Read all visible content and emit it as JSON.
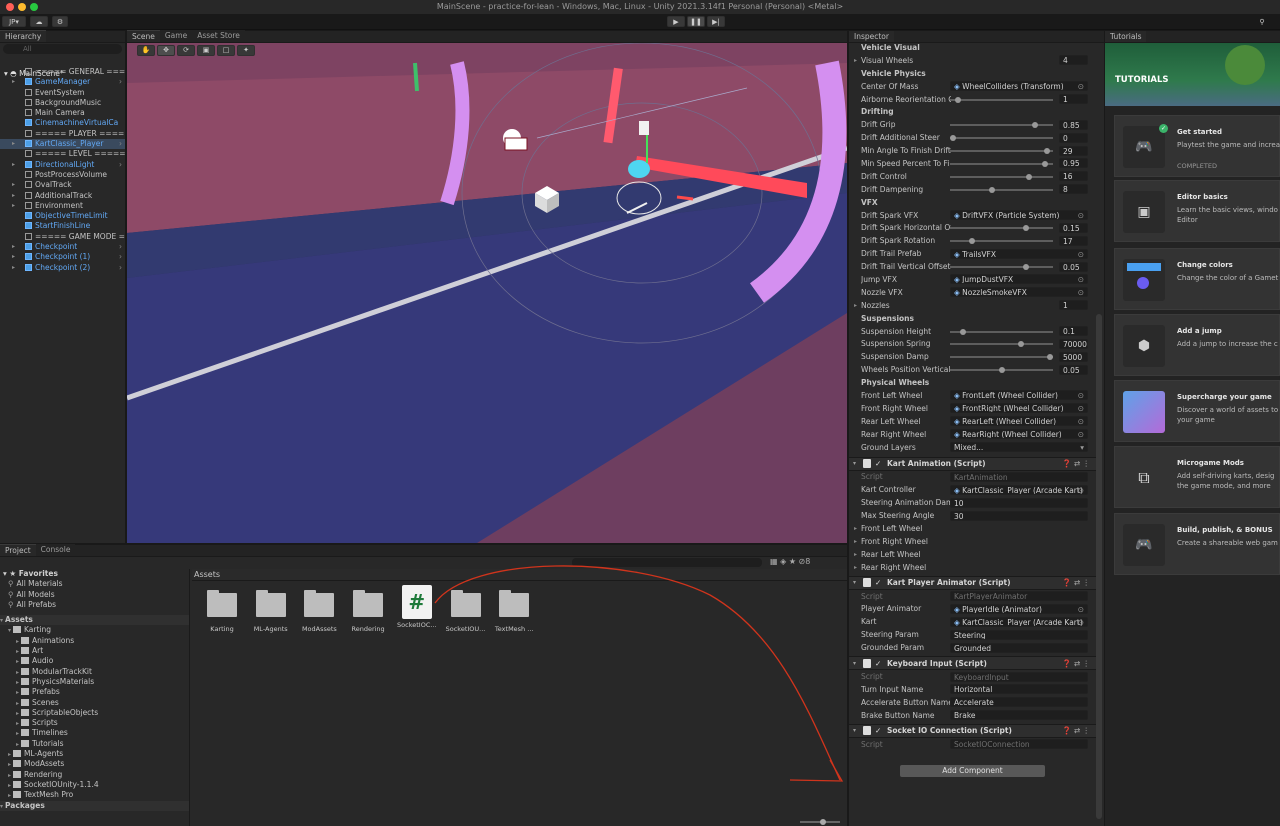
{
  "window": {
    "title": "MainScene - practice-for-lean - Windows, Mac, Linux - Unity 2021.3.14f1 Personal (Personal) <Metal>"
  },
  "toolbar": {
    "account": "JP"
  },
  "hierarchy": {
    "tab": "Hierarchy",
    "search_placeholder": "All",
    "scene": "MainScene*",
    "items": [
      {
        "label": "===== GENERAL =====",
        "blue": false,
        "arrow": false
      },
      {
        "label": "GameManager",
        "blue": true,
        "arrow": true
      },
      {
        "label": "EventSystem",
        "blue": false,
        "arrow": false
      },
      {
        "label": "BackgroundMusic",
        "blue": false,
        "arrow": false
      },
      {
        "label": "Main Camera",
        "blue": false,
        "arrow": false
      },
      {
        "label": "CinemachineVirtualCa",
        "blue": true,
        "arrow": false
      },
      {
        "label": "===== PLAYER =====",
        "blue": false,
        "arrow": false
      },
      {
        "label": "KartClassic_Player",
        "blue": true,
        "arrow": true
      },
      {
        "label": "===== LEVEL =====",
        "blue": false,
        "arrow": false
      },
      {
        "label": "DirectionalLight",
        "blue": true,
        "arrow": true
      },
      {
        "label": "PostProcessVolume",
        "blue": false,
        "arrow": false
      },
      {
        "label": "OvalTrack",
        "blue": false,
        "arrow": true
      },
      {
        "label": "AdditionalTrack",
        "blue": false,
        "arrow": true
      },
      {
        "label": "Environment",
        "blue": false,
        "arrow": true
      },
      {
        "label": "ObjectiveTimeLimit",
        "blue": true,
        "arrow": false
      },
      {
        "label": "StartFinishLine",
        "blue": true,
        "arrow": false
      },
      {
        "label": "===== GAME MODE ==",
        "blue": false,
        "arrow": false
      },
      {
        "label": "Checkpoint",
        "blue": true,
        "arrow": true
      },
      {
        "label": "Checkpoint (1)",
        "blue": true,
        "arrow": true
      },
      {
        "label": "Checkpoint (2)",
        "blue": true,
        "arrow": true
      }
    ]
  },
  "scene_tabs": {
    "scene": "Scene",
    "game": "Game",
    "asset_store": "Asset Store"
  },
  "project": {
    "tab": "Project",
    "console_tab": "Console",
    "assets_header": "Assets",
    "hidden_count": "8",
    "favorites_label": "Favorites",
    "favorites": [
      "All Materials",
      "All Models",
      "All Prefabs"
    ],
    "tree": [
      {
        "label": "Assets",
        "depth": 0,
        "bold": true
      },
      {
        "label": "Karting",
        "depth": 1
      },
      {
        "label": "Animations",
        "depth": 2
      },
      {
        "label": "Art",
        "depth": 2
      },
      {
        "label": "Audio",
        "depth": 2
      },
      {
        "label": "ModularTrackKit",
        "depth": 2
      },
      {
        "label": "PhysicsMaterials",
        "depth": 2
      },
      {
        "label": "Prefabs",
        "depth": 2
      },
      {
        "label": "Scenes",
        "depth": 2
      },
      {
        "label": "ScriptableObjects",
        "depth": 2
      },
      {
        "label": "Scripts",
        "depth": 2
      },
      {
        "label": "Timelines",
        "depth": 2
      },
      {
        "label": "Tutorials",
        "depth": 2
      },
      {
        "label": "ML-Agents",
        "depth": 1
      },
      {
        "label": "ModAssets",
        "depth": 1
      },
      {
        "label": "Rendering",
        "depth": 1
      },
      {
        "label": "SocketIOUnity-1.1.4",
        "depth": 1
      },
      {
        "label": "TextMesh Pro",
        "depth": 1
      },
      {
        "label": "Packages",
        "depth": 0,
        "bold": true
      }
    ],
    "grid": [
      {
        "label": "Karting",
        "kind": "folder"
      },
      {
        "label": "ML-Agents",
        "kind": "folder"
      },
      {
        "label": "ModAssets",
        "kind": "folder"
      },
      {
        "label": "Rendering",
        "kind": "folder"
      },
      {
        "label": "SocketIOC...",
        "kind": "script"
      },
      {
        "label": "SocketIOU...",
        "kind": "folder"
      },
      {
        "label": "TextMesh ...",
        "kind": "folder"
      }
    ]
  },
  "inspector": {
    "tab": "Inspector",
    "add_component": "Add Component",
    "rows1": [
      {
        "t": "sect",
        "label": "Vehicle Visual"
      },
      {
        "t": "fold",
        "label": "Visual Wheels",
        "value": "4"
      },
      {
        "t": "sect",
        "label": "Vehicle Physics"
      },
      {
        "t": "obj",
        "label": "Center Of Mass",
        "value": "WheelColliders (Transform)"
      },
      {
        "t": "slider",
        "label": "Airborne Reorientation C",
        "pos": 0.05,
        "value": "1"
      },
      {
        "t": "sect",
        "label": "Drifting"
      },
      {
        "t": "slider",
        "label": "Drift Grip",
        "pos": 0.85,
        "value": "0.85"
      },
      {
        "t": "slider",
        "label": "Drift Additional Steer",
        "pos": 0.0,
        "value": "0"
      },
      {
        "t": "slider",
        "label": "Min Angle To Finish Drift",
        "pos": 0.97,
        "value": "29"
      },
      {
        "t": "slider",
        "label": "Min Speed Percent To Fi",
        "pos": 0.95,
        "value": "0.95"
      },
      {
        "t": "slider",
        "label": "Drift Control",
        "pos": 0.78,
        "value": "16"
      },
      {
        "t": "slider",
        "label": "Drift Dampening",
        "pos": 0.4,
        "value": "8"
      },
      {
        "t": "sect",
        "label": "VFX"
      },
      {
        "t": "obj",
        "label": "Drift Spark VFX",
        "value": "DriftVFX (Particle System)"
      },
      {
        "t": "slider",
        "label": "Drift Spark Horizontal Off",
        "pos": 0.75,
        "value": "0.15"
      },
      {
        "t": "slider",
        "label": "Drift Spark Rotation",
        "pos": 0.2,
        "value": "17"
      },
      {
        "t": "obj",
        "label": "Drift Trail Prefab",
        "value": "TrailsVFX"
      },
      {
        "t": "slider",
        "label": "Drift Trail Vertical Offset",
        "pos": 0.75,
        "value": "0.05"
      },
      {
        "t": "obj",
        "label": "Jump VFX",
        "value": "JumpDustVFX"
      },
      {
        "t": "obj",
        "label": "Nozzle VFX",
        "value": "NozzleSmokeVFX"
      },
      {
        "t": "fold",
        "label": "Nozzles",
        "value": "1"
      },
      {
        "t": "sect",
        "label": "Suspensions"
      },
      {
        "t": "slider",
        "label": "Suspension Height",
        "pos": 0.1,
        "value": "0.1"
      },
      {
        "t": "slider",
        "label": "Suspension Spring",
        "pos": 0.7,
        "value": "70000"
      },
      {
        "t": "slider",
        "label": "Suspension Damp",
        "pos": 1.0,
        "value": "5000"
      },
      {
        "t": "slider",
        "label": "Wheels Position Vertical",
        "pos": 0.5,
        "value": "0.05"
      },
      {
        "t": "sect",
        "label": "Physical Wheels"
      },
      {
        "t": "obj",
        "label": "Front Left Wheel",
        "value": "FrontLeft (Wheel Collider)"
      },
      {
        "t": "obj",
        "label": "Front Right Wheel",
        "value": "FrontRight (Wheel Collider)"
      },
      {
        "t": "obj",
        "label": "Rear Left Wheel",
        "value": "RearLeft (Wheel Collider)"
      },
      {
        "t": "obj",
        "label": "Rear Right Wheel",
        "value": "RearRight (Wheel Collider)"
      },
      {
        "t": "drop",
        "label": "Ground Layers",
        "value": "Mixed..."
      }
    ],
    "kart_animation": {
      "title": "Kart Animation (Script)",
      "script_label": "Script",
      "script": "KartAnimation",
      "rows": [
        {
          "t": "obj",
          "label": "Kart Controller",
          "value": "KartClassic_Player (Arcade Kart)"
        },
        {
          "t": "text",
          "label": "Steering Animation Damp",
          "value": "10"
        },
        {
          "t": "text",
          "label": "Max Steering Angle",
          "value": "30"
        },
        {
          "t": "fold",
          "label": "Front Left Wheel",
          "value": ""
        },
        {
          "t": "fold",
          "label": "Front Right Wheel",
          "value": ""
        },
        {
          "t": "fold",
          "label": "Rear Left Wheel",
          "value": ""
        },
        {
          "t": "fold",
          "label": "Rear Right Wheel",
          "value": ""
        }
      ]
    },
    "kart_player_animator": {
      "title": "Kart Player Animator (Script)",
      "script_label": "Script",
      "script": "KartPlayerAnimator",
      "rows": [
        {
          "t": "obj",
          "label": "Player Animator",
          "value": "PlayerIdle (Animator)"
        },
        {
          "t": "obj",
          "label": "Kart",
          "value": "KartClassic_Player (Arcade Kart)"
        },
        {
          "t": "text",
          "label": "Steering Param",
          "value": "Steering"
        },
        {
          "t": "text",
          "label": "Grounded Param",
          "value": "Grounded"
        }
      ]
    },
    "keyboard_input": {
      "title": "Keyboard Input (Script)",
      "script_label": "Script",
      "script": "KeyboardInput",
      "rows": [
        {
          "t": "text",
          "label": "Turn Input Name",
          "value": "Horizontal"
        },
        {
          "t": "text",
          "label": "Accelerate Button Name",
          "value": "Accelerate"
        },
        {
          "t": "text",
          "label": "Brake Button Name",
          "value": "Brake"
        }
      ]
    },
    "socket_io": {
      "title": "Socket IO Connection (Script)",
      "script_label": "Script",
      "script": "SocketIOConnection"
    }
  },
  "tutorials": {
    "tab": "Tutorials",
    "header": "TUTORIALS",
    "cards": [
      {
        "title": "Get started",
        "desc": "Playtest the game and increa",
        "status": "COMPLETED",
        "icon": "gamepad-icon"
      },
      {
        "title": "Editor basics",
        "desc": "Learn the basic views, windo Editor",
        "status": "",
        "icon": "cube-window-icon"
      },
      {
        "title": "Change colors",
        "desc": "Change the color of a Gamet",
        "status": "",
        "icon": "palette-icon"
      },
      {
        "title": "Add a jump",
        "desc": "Add a jump to increase the c",
        "status": "",
        "icon": "jump-cube-icon"
      },
      {
        "title": "Supercharge your game",
        "desc": "Discover a world of assets to your game",
        "status": "",
        "icon": "kart-image-icon"
      },
      {
        "title": "Microgame Mods",
        "desc": "Add self-driving karts, desig the game mode, and more",
        "status": "",
        "icon": "external-link-icon"
      },
      {
        "title": "Build, publish, & BONUS",
        "desc": "Create a shareable web gam",
        "status": "",
        "icon": "www-gamepad-icon"
      }
    ]
  }
}
